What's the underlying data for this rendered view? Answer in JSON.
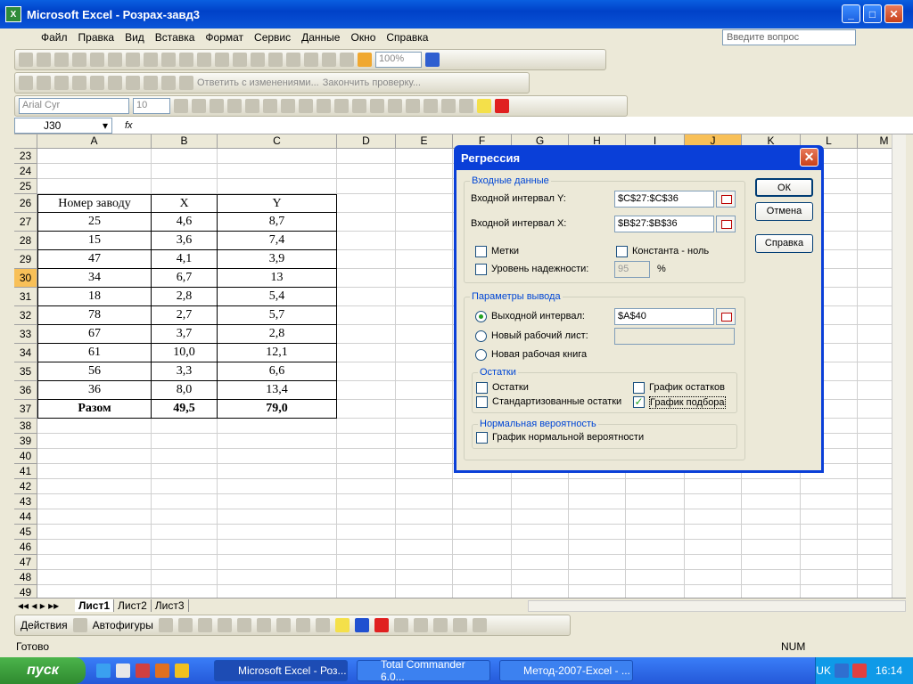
{
  "window": {
    "title": "Microsoft Excel - Розрах-завд3"
  },
  "menu": {
    "items": [
      "Файл",
      "Правка",
      "Вид",
      "Вставка",
      "Формат",
      "Сервис",
      "Данные",
      "Окно",
      "Справка"
    ],
    "ask_placeholder": "Введите вопрос"
  },
  "toolbar": {
    "zoom": "100%",
    "review_reply": "Ответить с изменениями...",
    "review_end": "Закончить проверку...",
    "font_name": "Arial Cyr",
    "font_size": "10"
  },
  "formula_bar": {
    "name_box": "J30",
    "fx": "fx"
  },
  "sheet": {
    "columns": [
      "A",
      "B",
      "C",
      "D",
      "E",
      "F",
      "G",
      "H",
      "I",
      "J",
      "K",
      "L",
      "M"
    ],
    "rows": [
      "23",
      "24",
      "25",
      "26",
      "27",
      "28",
      "29",
      "30",
      "31",
      "32",
      "33",
      "34",
      "35",
      "36",
      "37",
      "38",
      "39",
      "40",
      "41",
      "42",
      "43",
      "44",
      "45",
      "46",
      "47",
      "48",
      "49"
    ],
    "table_header": [
      "Номер заводу",
      "X",
      "Y"
    ],
    "table_rows": [
      [
        "25",
        "4,6",
        "8,7"
      ],
      [
        "15",
        "3,6",
        "7,4"
      ],
      [
        "47",
        "4,1",
        "3,9"
      ],
      [
        "34",
        "6,7",
        "13"
      ],
      [
        "18",
        "2,8",
        "5,4"
      ],
      [
        "78",
        "2,7",
        "5,7"
      ],
      [
        "67",
        "3,7",
        "2,8"
      ],
      [
        "61",
        "10,0",
        "12,1"
      ],
      [
        "56",
        "3,3",
        "6,6"
      ],
      [
        "36",
        "8,0",
        "13,4"
      ]
    ],
    "total_row": [
      "Разом",
      "49,5",
      "79,0"
    ]
  },
  "tabs": [
    "Лист1",
    "Лист2",
    "Лист3"
  ],
  "drawing": {
    "actions": "Действия",
    "autoshapes": "Автофигуры"
  },
  "status": {
    "left": "Готово",
    "num": "NUM"
  },
  "dialog": {
    "title": "Регрессия",
    "input_group": "Входные данные",
    "y_label": "Входной интервал Y:",
    "y_value": "$C$27:$C$36",
    "x_label": "Входной интервал X:",
    "x_value": "$B$27:$B$36",
    "labels": "Метки",
    "const_zero": "Константа - ноль",
    "confidence": "Уровень надежности:",
    "confidence_value": "95",
    "percent": "%",
    "output_group": "Параметры вывода",
    "output_range": "Выходной интервал:",
    "output_value": "$A$40",
    "new_sheet": "Новый рабочий лист:",
    "new_book": "Новая рабочая книга",
    "residuals_group": "Остатки",
    "residuals": "Остатки",
    "std_residuals": "Стандартизованные остатки",
    "residual_plots": "График остатков",
    "line_fit": "График подбора",
    "normal_group": "Нормальная вероятность",
    "normal_plot": "График нормальной вероятности",
    "ok": "ОК",
    "cancel": "Отмена",
    "help": "Справка"
  },
  "taskbar": {
    "start": "пуск",
    "tasks": [
      "Microsoft Excel - Роз...",
      "Total Commander 6.0...",
      "Метод-2007-Excel - ..."
    ],
    "lang": "UK",
    "time": "16:14"
  }
}
